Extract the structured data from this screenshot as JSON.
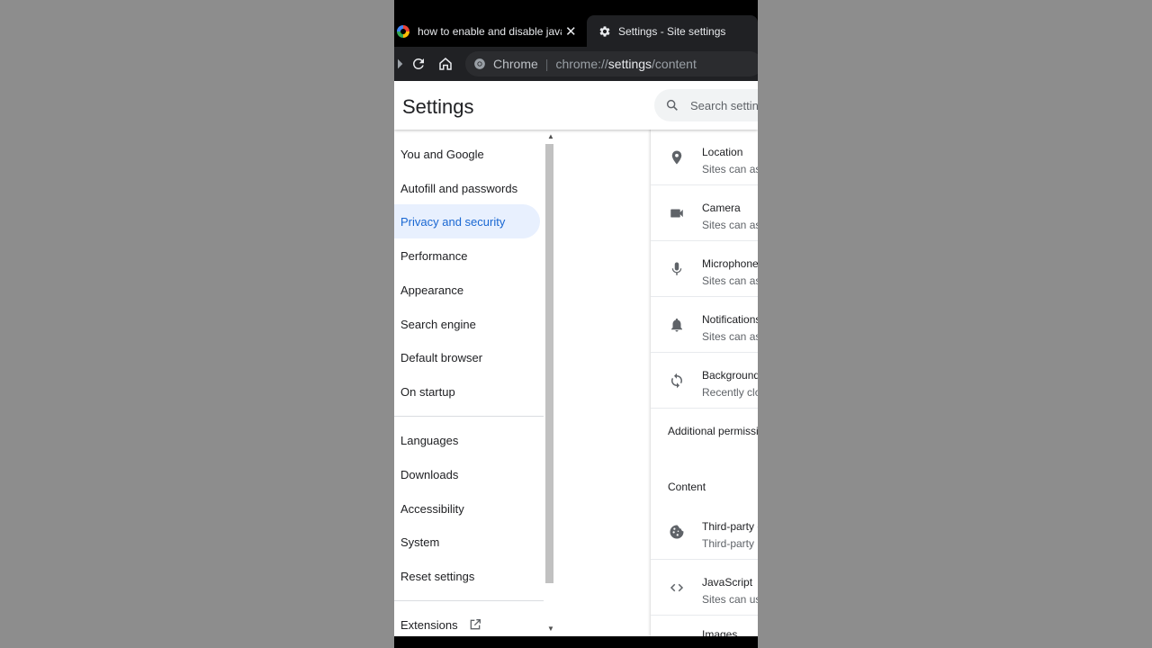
{
  "tabs": [
    {
      "title": "how to enable and disable javascript",
      "favicon": "google-g-icon",
      "active": false
    },
    {
      "title": "Settings - Site settings",
      "favicon": "gear-icon",
      "active": true
    }
  ],
  "toolbar": {
    "omnibox_chip": "Chrome",
    "url_prefix": "chrome://",
    "url_host": "settings",
    "url_path": "/content"
  },
  "settings": {
    "title": "Settings",
    "search_placeholder": "Search settings"
  },
  "sidebar": {
    "items": [
      {
        "label": "You and Google"
      },
      {
        "label": "Autofill and passwords"
      },
      {
        "label": "Privacy and security",
        "selected": true
      },
      {
        "label": "Performance"
      },
      {
        "label": "Appearance"
      },
      {
        "label": "Search engine"
      },
      {
        "label": "Default browser"
      },
      {
        "label": "On startup"
      },
      {
        "label": "Languages"
      },
      {
        "label": "Downloads"
      },
      {
        "label": "Accessibility"
      },
      {
        "label": "System"
      },
      {
        "label": "Reset settings"
      },
      {
        "label": "Extensions"
      }
    ]
  },
  "permissions": [
    {
      "title": "Location",
      "subtitle": "Sites can ask",
      "icon": "location-pin-icon"
    },
    {
      "title": "Camera",
      "subtitle": "Sites can ask",
      "icon": "camera-icon"
    },
    {
      "title": "Microphone",
      "subtitle": "Sites can ask",
      "icon": "microphone-icon"
    },
    {
      "title": "Notifications",
      "subtitle": "Sites can ask",
      "icon": "bell-icon"
    },
    {
      "title": "Background sync",
      "subtitle": "Recently closed",
      "icon": "sync-icon"
    }
  ],
  "additional_permissions_label": "Additional permissions",
  "content_section_label": "Content",
  "content_items": [
    {
      "title": "Third-party cookies",
      "subtitle": "Third-party",
      "icon": "cookie-icon"
    },
    {
      "title": "JavaScript",
      "subtitle": "Sites can use",
      "icon": "code-brackets-icon"
    },
    {
      "title": "Images",
      "subtitle": "",
      "icon": "image-icon"
    }
  ],
  "colors": {
    "accent": "#1967d2",
    "selected_bg": "#e8f0fe",
    "page_bg": "#ffffff",
    "chrome_dark": "#202124"
  }
}
